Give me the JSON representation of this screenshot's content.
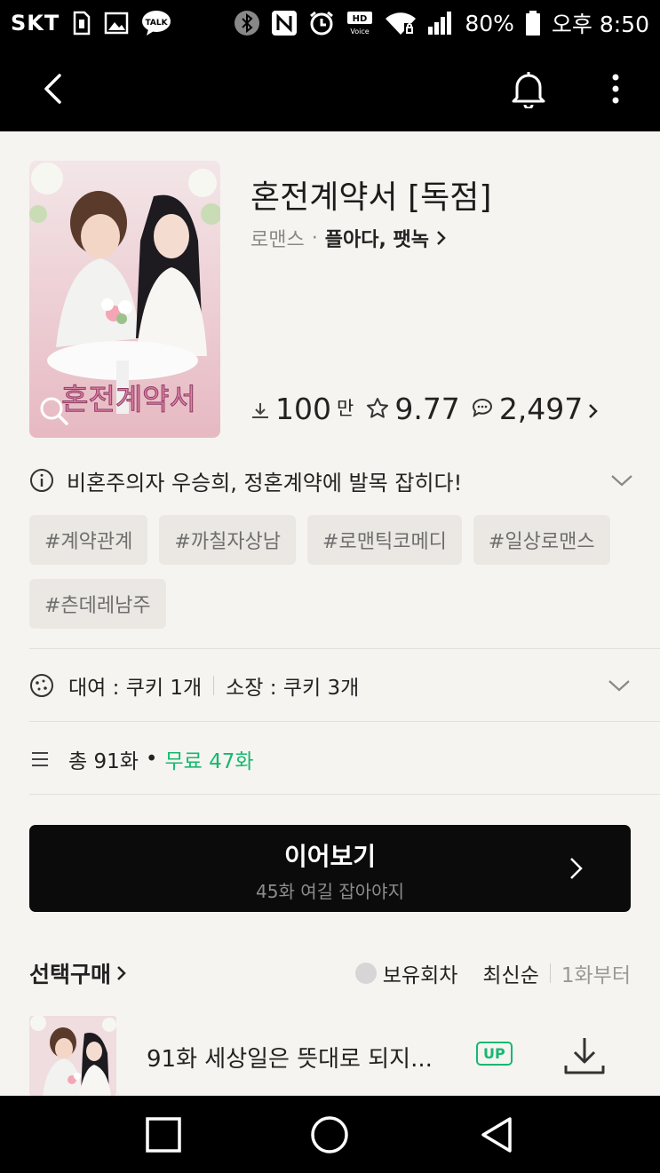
{
  "status_bar": {
    "carrier": "SKT",
    "battery": "80%",
    "time": "오후 8:50",
    "hd_voice": "HD",
    "hd_voice_sub": "Voice",
    "talk_label": "TALK",
    "icons": [
      "sim-icon",
      "gallery-icon",
      "kakaotalk-icon",
      "bluetooth-icon",
      "nfc-icon",
      "alarm-icon",
      "hd-voice-icon",
      "wifi-icon",
      "signal-icon",
      "battery-icon"
    ]
  },
  "app_bar": {
    "back_icon": "chevron-left-icon",
    "bell_icon": "bell-icon",
    "more_icon": "more-vertical-icon"
  },
  "book": {
    "title": "혼전계약서 [독점]",
    "genre": "로맨스",
    "dot": "·",
    "authors": "플아다, 팻녹",
    "cover_text": "혼전계약서",
    "downloads": "100",
    "downloads_unit": "만",
    "rating": "9.77",
    "comments": "2,497"
  },
  "synopsis": "비혼주의자 우승희, 정혼계약에 발목 잡히다!",
  "tags": [
    "#계약관계",
    "#까칠자상남",
    "#로맨틱코메디",
    "#일상로맨스",
    "#츤데레남주"
  ],
  "cookies": {
    "rent": "대여 : 쿠키 1개",
    "own": "소장 : 쿠키 3개"
  },
  "episodes_info": {
    "total": "총 91화",
    "dot": "•",
    "free": "무료 47화"
  },
  "continue_button": {
    "label": "이어보기",
    "sub": "45화 여길 잡아야지"
  },
  "purchase": {
    "title": "선택구매",
    "owned": "보유회차",
    "sort_latest": "최신순",
    "sort_first": "1화부터"
  },
  "episode": {
    "title": "91화 세상일은 뜻대로 되지...",
    "badge": "UP"
  },
  "colors": {
    "accent_green": "#16b86f",
    "bar_black": "#000000",
    "background": "#f6f4f0",
    "tag_bg": "#ebe8e3"
  }
}
